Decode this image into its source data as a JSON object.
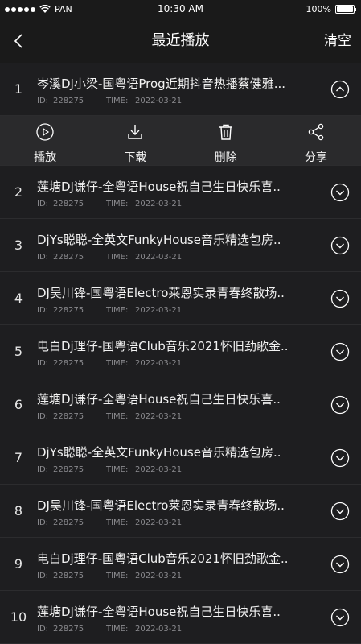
{
  "status": {
    "carrier": "PAN",
    "time": "10:30 AM",
    "battery": "100%"
  },
  "nav": {
    "title": "最近播放",
    "clear_label": "清空"
  },
  "meta_labels": {
    "id": "ID:",
    "time": "TIME:"
  },
  "actions": [
    {
      "label": "播放",
      "icon": "play-circle-icon"
    },
    {
      "label": "下载",
      "icon": "download-icon"
    },
    {
      "label": "删除",
      "icon": "trash-icon"
    },
    {
      "label": "分享",
      "icon": "share-icon"
    }
  ],
  "tracks": [
    {
      "num": "1",
      "title": "岑溪DJ小梁-国粤语Prog近期抖音热播蔡健雅...",
      "id": "228275",
      "time": "2022-03-21",
      "expanded": true
    },
    {
      "num": "2",
      "title": "莲塘DJ谦仔-全粤语House祝自己生日快乐喜..",
      "id": "228275",
      "time": "2022-03-21",
      "expanded": false
    },
    {
      "num": "3",
      "title": "DjYs聪聪-全英文FunkyHouse音乐精选包房..",
      "id": "228275",
      "time": "2022-03-21",
      "expanded": false
    },
    {
      "num": "4",
      "title": "DJ吴川锋-国粤语Electro莱恩实录青春终散场..",
      "id": "228275",
      "time": "2022-03-21",
      "expanded": false
    },
    {
      "num": "5",
      "title": "电白Dj理仔-国粤语Club音乐2021怀旧劲歌金..",
      "id": "228275",
      "time": "2022-03-21",
      "expanded": false
    },
    {
      "num": "6",
      "title": "莲塘DJ谦仔-全粤语House祝自己生日快乐喜..",
      "id": "228275",
      "time": "2022-03-21",
      "expanded": false
    },
    {
      "num": "7",
      "title": "DjYs聪聪-全英文FunkyHouse音乐精选包房..",
      "id": "228275",
      "time": "2022-03-21",
      "expanded": false
    },
    {
      "num": "8",
      "title": "DJ吴川锋-国粤语Electro莱恩实录青春终散场..",
      "id": "228275",
      "time": "2022-03-21",
      "expanded": false
    },
    {
      "num": "9",
      "title": "电白Dj理仔-国粤语Club音乐2021怀旧劲歌金..",
      "id": "228275",
      "time": "2022-03-21",
      "expanded": false
    },
    {
      "num": "10",
      "title": "莲塘DJ谦仔-全粤语House祝自己生日快乐喜..",
      "id": "228275",
      "time": "2022-03-21",
      "expanded": false
    }
  ]
}
